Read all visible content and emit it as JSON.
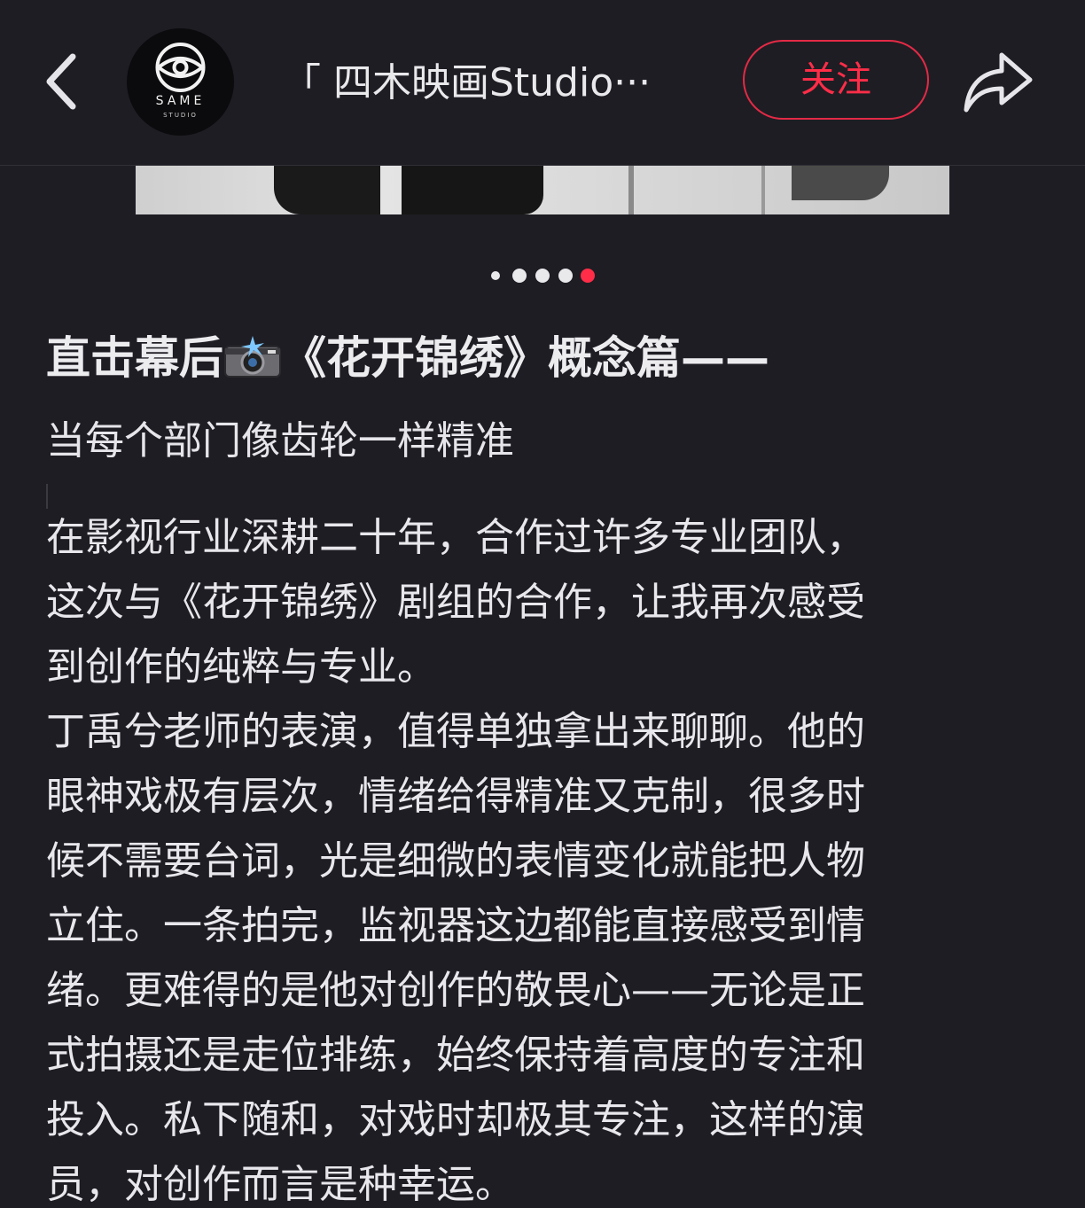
{
  "header": {
    "account_name": "「 四木映画Studio···",
    "avatar_brand": "SAME",
    "avatar_brand_sub": "STUDIO",
    "follow_label": "关注",
    "icons": {
      "back": "chevron-left-icon",
      "share": "share-arrow-icon",
      "avatar": "same-studio-eye-logo"
    }
  },
  "carousel": {
    "total": 5,
    "active_index": 4,
    "active_color": "#ff2d48",
    "inactive_color": "#e9e9ec"
  },
  "post": {
    "title_part1": "直击幕后",
    "title_icon": "camera-flash-icon",
    "title_part2": "《花开锦绣》概念篇——",
    "subtitle": "当每个部门像齿轮一样精准",
    "body_lines": [
      "在影视行业深耕二十年，合作过许多专业团队，",
      "这次与《花开锦绣》剧组的合作，让我再次感受",
      "到创作的纯粹与专业。",
      "丁禹兮老师的表演，值得单独拿出来聊聊。他的",
      "眼神戏极有层次，情绪给得精准又克制，很多时",
      "候不需要台词，光是细微的表情变化就能把人物",
      "立住。一条拍完，监视器这边都能直接感受到情",
      "绪。更难得的是他对创作的敬畏心——无论是正",
      "式拍摄还是走位排练，始终保持着高度的专注和",
      "投入。私下随和，对戏时却极其专注，这样的演",
      "员，对创作而言是种幸运。"
    ]
  },
  "colors": {
    "background": "#1e1d23",
    "text": "#e8e8ec",
    "accent": "#ff2d48"
  }
}
